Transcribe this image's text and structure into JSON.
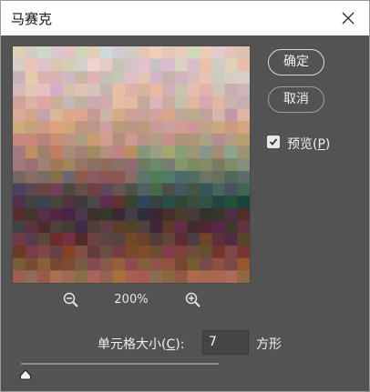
{
  "window": {
    "title": "马赛克"
  },
  "buttons": {
    "ok_label": "确定",
    "cancel_label": "取消"
  },
  "preview_toggle": {
    "label_prefix": "预览(",
    "mnemonic": "P",
    "label_suffix": ")",
    "checked": true
  },
  "zoom": {
    "level": "200%"
  },
  "cell_size": {
    "label_prefix": "单元格大小(",
    "mnemonic": "C",
    "label_suffix": "):",
    "value": "7",
    "unit": "方形",
    "slider_fraction": 0.01
  },
  "colors": {
    "dialog_bg": "#535353",
    "input_bg": "#454545",
    "text": "#f0f0f0"
  },
  "icons": {
    "close": "close-icon",
    "zoom_out": "zoom-out-icon",
    "zoom_in": "zoom-in-icon",
    "check": "check-icon",
    "slider_thumb": "slider-thumb-icon"
  }
}
